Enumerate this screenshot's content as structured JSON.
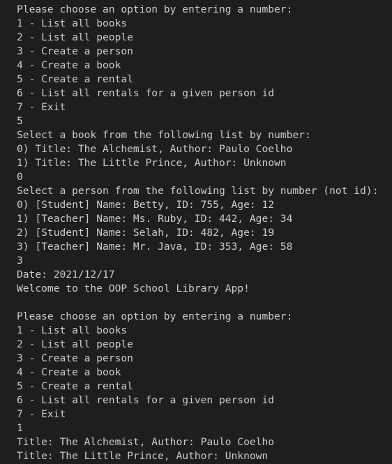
{
  "terminal": {
    "lines": [
      "Please choose an option by entering a number:",
      "1 - List all books",
      "2 - List all people",
      "3 - Create a person",
      "4 - Create a book",
      "5 - Create a rental",
      "6 - List all rentals for a given person id",
      "7 - Exit",
      "5",
      "Select a book from the following list by number:",
      "0) Title: The Alchemist, Author: Paulo Coelho",
      "1) Title: The Little Prince, Author: Unknown",
      "0",
      "Select a person from the following list by number (not id):",
      "0) [Student] Name: Betty, ID: 755, Age: 12",
      "1) [Teacher] Name: Ms. Ruby, ID: 442, Age: 34",
      "2) [Student] Name: Selah, ID: 482, Age: 19",
      "3) [Teacher] Name: Mr. Java, ID: 353, Age: 58",
      "3",
      "Date: 2021/12/17",
      "Welcome to the OOP School Library App!",
      "",
      "Please choose an option by entering a number:",
      "1 - List all books",
      "2 - List all people",
      "3 - Create a person",
      "4 - Create a book",
      "5 - Create a rental",
      "6 - List all rentals for a given person id",
      "7 - Exit",
      "1",
      "Title: The Alchemist, Author: Paulo Coelho",
      "Title: The Little Prince, Author: Unknown"
    ]
  }
}
